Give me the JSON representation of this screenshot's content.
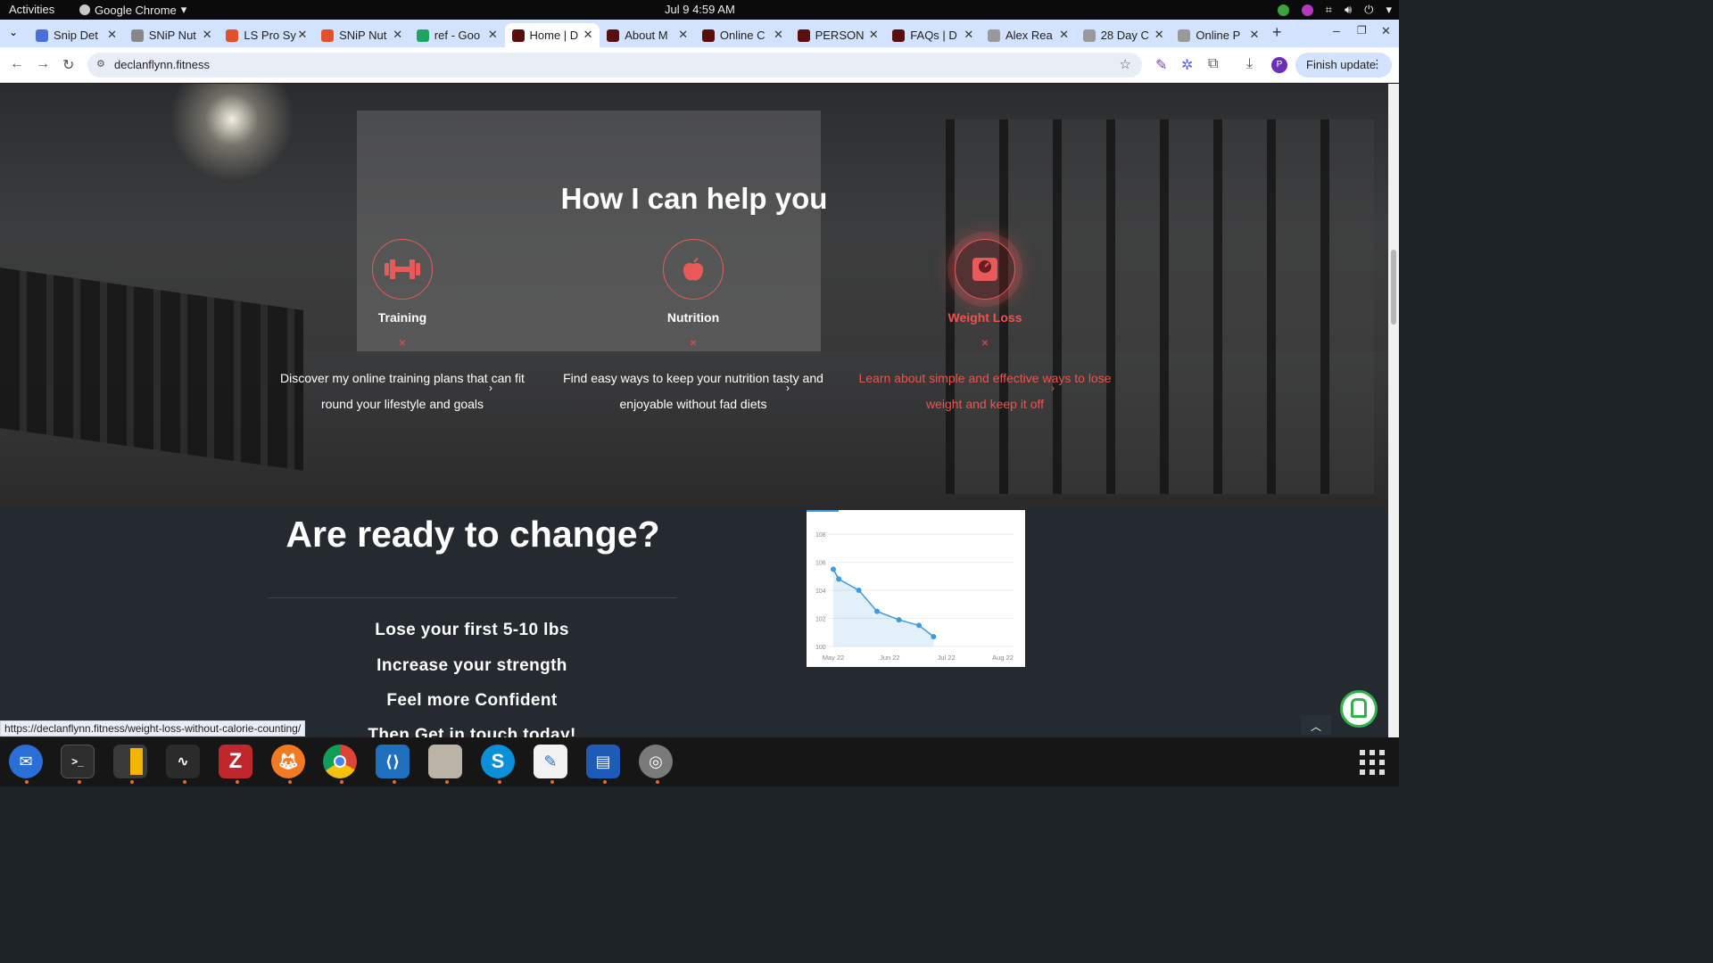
{
  "system": {
    "activities": "Activities",
    "app_name": "Google Chrome",
    "clock": "Jul 9  4:59 AM"
  },
  "tabs": [
    {
      "title": "Snip Det",
      "favicon_color": "#4a6fd8"
    },
    {
      "title": "SNiP Nut",
      "favicon_color": "#888888"
    },
    {
      "title": "LS Pro Sy",
      "favicon_color": "#e3502b"
    },
    {
      "title": "SNiP Nut",
      "favicon_color": "#e3502b"
    },
    {
      "title": "ref - Goo",
      "favicon_color": "#1fa463"
    },
    {
      "title": "Home | D",
      "favicon_color": "#5a0d0d",
      "active": true
    },
    {
      "title": "About M",
      "favicon_color": "#5a0d0d"
    },
    {
      "title": "Online C",
      "favicon_color": "#5a0d0d"
    },
    {
      "title": "PERSON",
      "favicon_color": "#5a0d0d"
    },
    {
      "title": "FAQs | D",
      "favicon_color": "#5a0d0d"
    },
    {
      "title": "Alex Rea",
      "favicon_color": "#999999"
    },
    {
      "title": "28 Day C",
      "favicon_color": "#999999"
    },
    {
      "title": "Online P",
      "favicon_color": "#999999"
    }
  ],
  "toolbar": {
    "url": "declanflynn.fitness",
    "finish_update": "Finish update",
    "profile_initial": "P"
  },
  "hero": {
    "title": "How I can help you",
    "services": [
      {
        "name": "Training",
        "icon": "dumbbell-icon",
        "description": "Discover my online training plans that can fit round your lifestyle and goals"
      },
      {
        "name": "Nutrition",
        "icon": "apple-icon",
        "description": "Find easy ways to keep your nutrition tasty and enjoyable without fad diets"
      },
      {
        "name": "Weight Loss",
        "icon": "scale-icon",
        "description": "Learn about simple and effective ways to lose weight and keep it off"
      }
    ],
    "x_mark": "×"
  },
  "cta": {
    "title": "Are ready to change?",
    "items": [
      "Lose your first 5-10 lbs",
      "Increase your strength",
      "Feel more Confident",
      "Then Get in touch today!"
    ]
  },
  "status_url": "https://declanflynn.fitness/weight-loss-without-calorie-counting/",
  "accent_color": "#ef5350",
  "chart_data": {
    "type": "area",
    "x_ticks": [
      "May 22",
      "Jun 22",
      "Jul 22",
      "Aug 22"
    ],
    "y_ticks": [
      100,
      102,
      104,
      106,
      108
    ],
    "ylim": [
      100,
      108
    ],
    "x": [
      "May 22",
      "May 25",
      "Jun 5",
      "Jun 15",
      "Jun 27",
      "Jul 7",
      "Jul 15"
    ],
    "values": [
      105.5,
      104.8,
      104.0,
      102.5,
      101.9,
      101.5,
      100.7
    ],
    "grid": true,
    "line_color": "#3d9be0"
  }
}
